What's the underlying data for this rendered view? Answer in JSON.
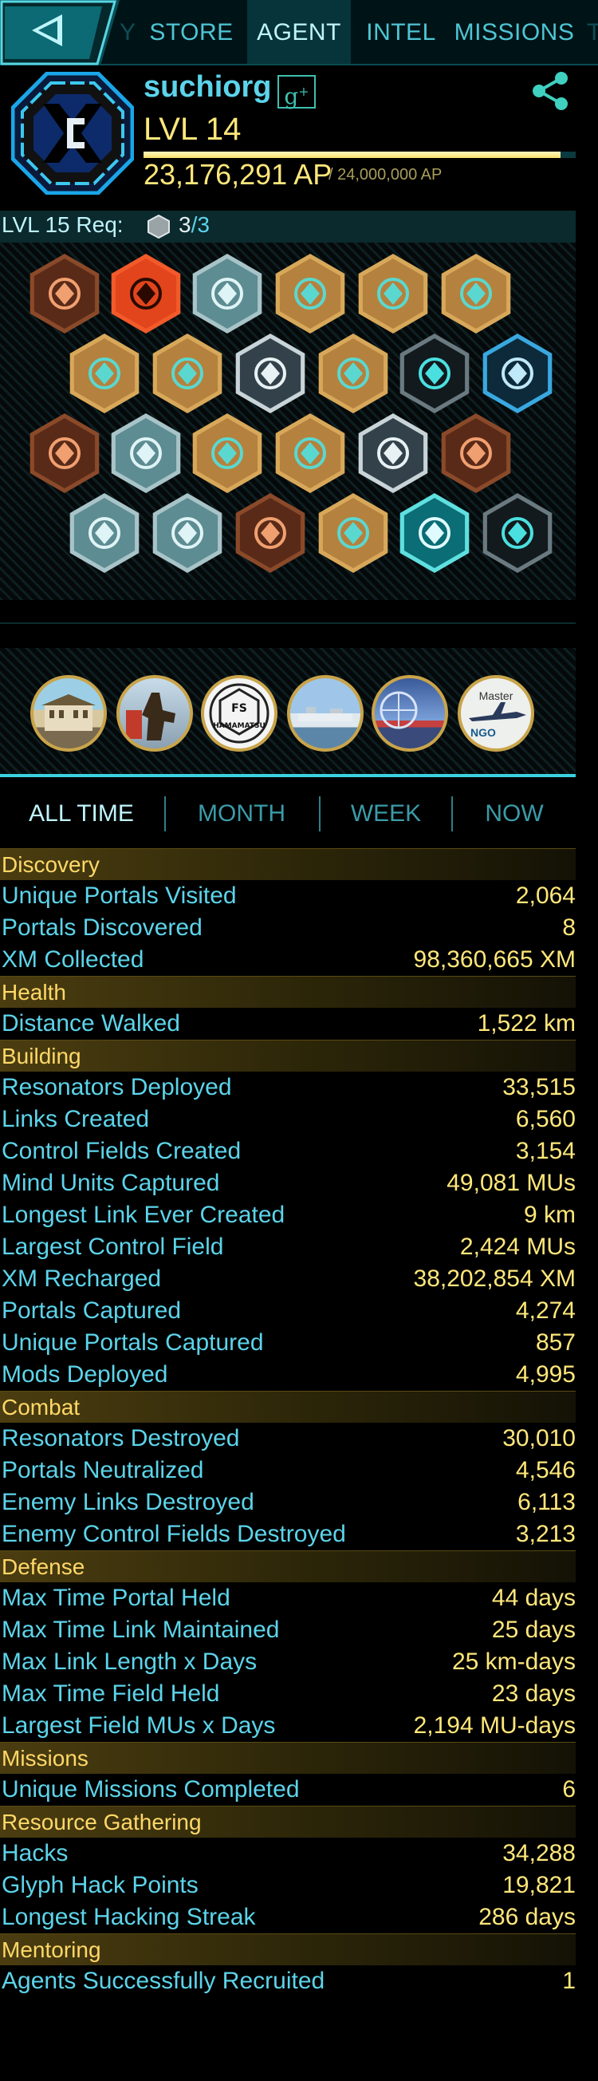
{
  "nav": {
    "prev_fragment": "Y",
    "next_fragment": "T",
    "tabs": [
      {
        "label": "STORE"
      },
      {
        "label": "AGENT"
      },
      {
        "label": "INTEL"
      },
      {
        "label": "MISSIONS"
      }
    ],
    "active_tab": "AGENT"
  },
  "agent": {
    "name": "suchiorg",
    "social_icon": "google-plus-icon",
    "level": "LVL 14",
    "ap": "23,176,291 AP",
    "ap_max": "/ 24,000,000 AP",
    "ap_progress": 0.9657,
    "faction_color": "#1e90ff"
  },
  "requirement": {
    "label": "LVL 15 Req:",
    "current": "3",
    "total": "/3"
  },
  "badges": [
    {
      "name": "badge-tiki",
      "tier": "bronze"
    },
    {
      "name": "badge-hex-logo",
      "tier": "red"
    },
    {
      "name": "badge-lattice",
      "tier": "silver"
    },
    {
      "name": "badge-splat",
      "tier": "gold"
    },
    {
      "name": "badge-compass",
      "tier": "gold"
    },
    {
      "name": "badge-ship",
      "tier": "gold"
    },
    {
      "name": "badge-plant",
      "tier": "gold"
    },
    {
      "name": "badge-cubes",
      "tier": "gold"
    },
    {
      "name": "badge-resonator",
      "tier": "platinum"
    },
    {
      "name": "badge-root",
      "tier": "gold"
    },
    {
      "name": "badge-eye",
      "tier": "black"
    },
    {
      "name": "badge-wings",
      "tier": "onyx"
    },
    {
      "name": "badge-links",
      "tier": "bronze"
    },
    {
      "name": "badge-walker",
      "tier": "silver"
    },
    {
      "name": "badge-mask",
      "tier": "gold"
    },
    {
      "name": "badge-dots",
      "tier": "gold"
    },
    {
      "name": "badge-fountain",
      "tier": "platinum"
    },
    {
      "name": "badge-people",
      "tier": "bronze"
    },
    {
      "name": "badge-hand-gear",
      "tier": "silver"
    },
    {
      "name": "badge-hand-map",
      "tier": "silver"
    },
    {
      "name": "badge-bird",
      "tier": "bronze"
    },
    {
      "name": "badge-fist",
      "tier": "gold"
    },
    {
      "name": "badge-check",
      "tier": "teal"
    },
    {
      "name": "badge-lock",
      "tier": "black"
    }
  ],
  "medals": [
    {
      "name": "medal-building"
    },
    {
      "name": "medal-statue"
    },
    {
      "name": "medal-fs-hamamatsu",
      "text": "FS HAMAMATSU"
    },
    {
      "name": "medal-harbor"
    },
    {
      "name": "medal-bridge"
    },
    {
      "name": "medal-master",
      "text_top": "Master",
      "text_bottom": "NGO"
    }
  ],
  "time_tabs": [
    "ALL TIME",
    "MONTH",
    "WEEK",
    "NOW"
  ],
  "active_time_tab": "ALL TIME",
  "stats": [
    {
      "section": "Discovery",
      "rows": [
        {
          "label": "Unique Portals Visited",
          "value": "2,064"
        },
        {
          "label": "Portals Discovered",
          "value": "8"
        },
        {
          "label": "XM Collected",
          "value": "98,360,665 XM"
        }
      ]
    },
    {
      "section": "Health",
      "rows": [
        {
          "label": "Distance Walked",
          "value": "1,522 km"
        }
      ]
    },
    {
      "section": "Building",
      "rows": [
        {
          "label": "Resonators Deployed",
          "value": "33,515"
        },
        {
          "label": "Links Created",
          "value": "6,560"
        },
        {
          "label": "Control Fields Created",
          "value": "3,154"
        },
        {
          "label": "Mind Units Captured",
          "value": "49,081 MUs"
        },
        {
          "label": "Longest Link Ever Created",
          "value": "9 km"
        },
        {
          "label": "Largest Control Field",
          "value": "2,424 MUs"
        },
        {
          "label": "XM Recharged",
          "value": "38,202,854 XM"
        },
        {
          "label": "Portals Captured",
          "value": "4,274"
        },
        {
          "label": "Unique Portals Captured",
          "value": "857"
        },
        {
          "label": "Mods Deployed",
          "value": "4,995"
        }
      ]
    },
    {
      "section": "Combat",
      "rows": [
        {
          "label": "Resonators Destroyed",
          "value": "30,010"
        },
        {
          "label": "Portals Neutralized",
          "value": "4,546"
        },
        {
          "label": "Enemy Links Destroyed",
          "value": "6,113"
        },
        {
          "label": "Enemy Control Fields Destroyed",
          "value": "3,213"
        }
      ]
    },
    {
      "section": "Defense",
      "rows": [
        {
          "label": "Max Time Portal Held",
          "value": "44 days"
        },
        {
          "label": "Max Time Link Maintained",
          "value": "25 days"
        },
        {
          "label": "Max Link Length x Days",
          "value": "25 km-days"
        },
        {
          "label": "Max Time Field Held",
          "value": "23 days"
        },
        {
          "label": "Largest Field MUs x Days",
          "value": "2,194 MU-days"
        }
      ]
    },
    {
      "section": "Missions",
      "rows": [
        {
          "label": "Unique Missions Completed",
          "value": "6"
        }
      ]
    },
    {
      "section": "Resource Gathering",
      "rows": [
        {
          "label": "Hacks",
          "value": "34,288"
        },
        {
          "label": "Glyph Hack Points",
          "value": "19,821"
        },
        {
          "label": "Longest Hacking Streak",
          "value": "286 days"
        }
      ]
    },
    {
      "section": "Mentoring",
      "rows": [
        {
          "label": "Agents Successfully Recruited",
          "value": "1"
        }
      ]
    }
  ]
}
